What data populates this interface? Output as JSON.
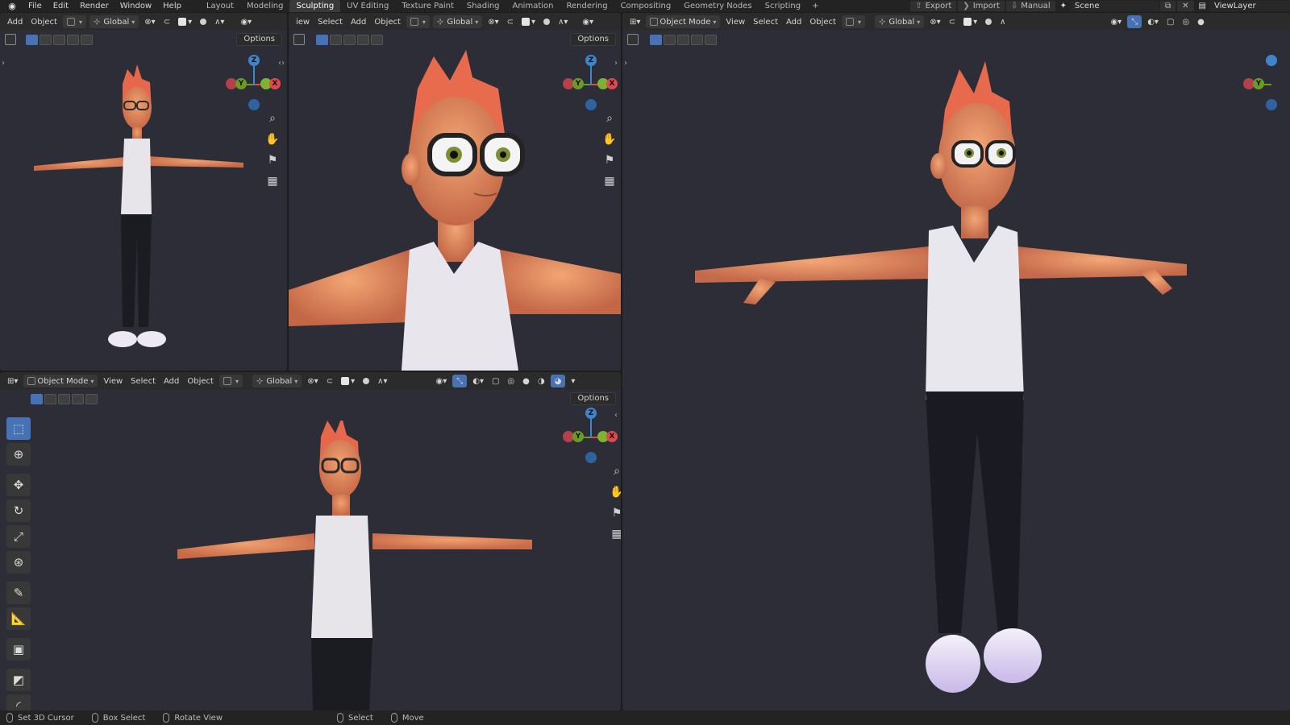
{
  "app": {
    "logo_label": "Blender"
  },
  "menu": [
    "File",
    "Edit",
    "Render",
    "Window",
    "Help"
  ],
  "workspaces": [
    "Layout",
    "Modeling",
    "Sculpting",
    "UV Editing",
    "Texture Paint",
    "Shading",
    "Animation",
    "Rendering",
    "Compositing",
    "Geometry Nodes",
    "Scripting"
  ],
  "active_workspace": "Sculpting",
  "add_workspace": "+",
  "top_right": {
    "export": "Export",
    "import": "Import",
    "manual": "Manual",
    "scene": "Scene",
    "view_layer": "ViewLayer"
  },
  "viewport_header": {
    "mode": "Object Mode",
    "view": "View",
    "select": "Select",
    "add": "Add",
    "object": "Object",
    "partial_view": "iew",
    "transform": "Global",
    "options": "Options"
  },
  "gizmo": {
    "z": "Z",
    "y": "Y",
    "x": "X"
  },
  "colors": {
    "x_axis": "#e0474f",
    "y_axis": "#6c9b25",
    "z_axis": "#3d85c8",
    "accent": "#4772b3",
    "viewport_bg": "#2d2d37"
  },
  "nav_icons": [
    "zoom-icon",
    "hand-pan-icon",
    "camera-icon",
    "grid-icon"
  ],
  "tools": [
    "select-box",
    "cursor",
    "move",
    "rotate",
    "scale",
    "transform",
    "annotate",
    "measure",
    "add-cube",
    "edge-slide",
    "shear"
  ],
  "statusbar": [
    "Set 3D Cursor",
    "Box Select",
    "Rotate View",
    "Select",
    "Move"
  ]
}
